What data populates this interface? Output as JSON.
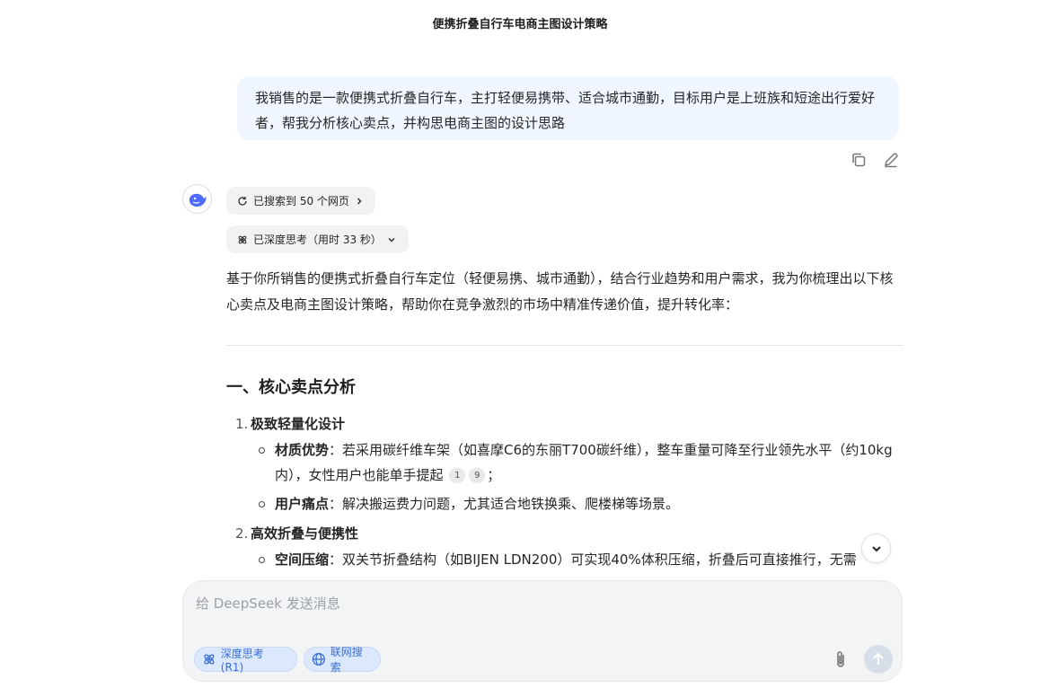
{
  "header": {
    "title": "便携折叠自行车电商主图设计策略"
  },
  "user_message": {
    "text": "我销售的是一款便携式折叠自行车，主打轻便易携带、适合城市通勤，目标用户是上班族和短途出行爱好者，帮我分析核心卖点，并构思电商主图的设计思路"
  },
  "assistant": {
    "search_pill": "已搜索到 50 个网页",
    "think_pill": "已深度思考（用时 33 秒）",
    "intro": "基于你所销售的便携式折叠自行车定位（轻便易携、城市通勤），结合行业趋势和用户需求，我为你梳理出以下核心卖点及电商主图设计策略，帮助你在竞争激烈的市场中精准传递价值，提升转化率：",
    "section_title": "一、核心卖点分析",
    "items": [
      {
        "num": "1.",
        "title": "极致轻量化设计",
        "bullets": [
          {
            "label": "材质优势",
            "text": "：若采用碳纤维车架（如喜摩C6的东丽T700碳纤维），整车重量可降至行业领先水平（约10kg内），女性用户也能单手提起",
            "cites": [
              "1",
              "9"
            ],
            "tail": "；"
          },
          {
            "label": "用户痛点",
            "text": "：解决搬运费力问题，尤其适合地铁换乘、爬楼梯等场景。",
            "cites": [],
            "tail": ""
          }
        ]
      },
      {
        "num": "2.",
        "title": "高效折叠与便携性",
        "bullets": [
          {
            "label": "空间压缩",
            "text": "：双关节折叠结构（如BIJEN LDN200）可实现40%体积压缩，折叠后可直接推行，无需",
            "cites": [],
            "tail": ""
          }
        ]
      }
    ]
  },
  "composer": {
    "placeholder": "给 DeepSeek 发送消息",
    "deep_think_label": "深度思考 (R1)",
    "web_search_label": "联网搜索"
  },
  "colors": {
    "accent": "#3b6fd6",
    "user_bubble": "#eff6ff",
    "pill_bg": "#f1f2f4"
  },
  "icons": [
    "copy-icon",
    "edit-icon",
    "deepseek-whale-icon",
    "refresh-search-icon",
    "chevron-right-icon",
    "atom-icon",
    "chevron-down-icon",
    "globe-icon",
    "paperclip-icon",
    "arrow-up-icon"
  ]
}
